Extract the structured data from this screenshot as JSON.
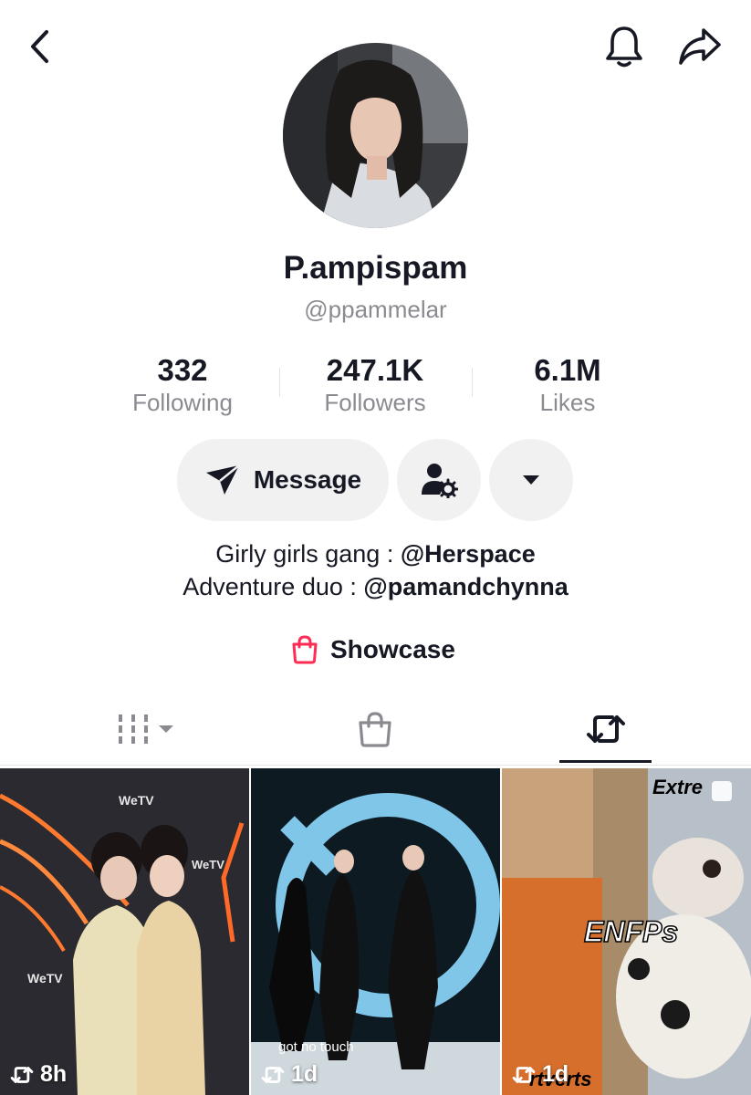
{
  "profile": {
    "display_name": "P.ampispam",
    "username": "@ppammelar"
  },
  "stats": [
    {
      "value": "332",
      "label": "Following"
    },
    {
      "value": "247.1K",
      "label": "Followers"
    },
    {
      "value": "6.1M",
      "label": "Likes"
    }
  ],
  "actions": {
    "message_label": "Message"
  },
  "bio": {
    "line1_text": "Girly girls gang : ",
    "line1_mention": "@Herspace",
    "line2_text": "Adventure duo : ",
    "line2_mention": "@pamandchynna"
  },
  "showcase": {
    "label": "Showcase"
  },
  "tabs": [
    {
      "name": "videos",
      "icon": "grid-icon",
      "active": false
    },
    {
      "name": "shop",
      "icon": "shopping-bag-icon",
      "active": false
    },
    {
      "name": "reposts",
      "icon": "repost-icon",
      "active": true
    }
  ],
  "videos": [
    {
      "time": "8h",
      "overlay_text": "WeTV",
      "icon": "repost-icon"
    },
    {
      "time": "1d",
      "overlay_text": "got no touch",
      "icon": "repost-icon"
    },
    {
      "time": "1d",
      "overlay_text": "ENFPs",
      "top_text": "Extre",
      "bottom_text": "rtverts",
      "icon": "repost-icon"
    }
  ],
  "colors": {
    "primary_text": "#161823",
    "secondary_text": "#8a8b91",
    "button_bg": "#f1f1f2",
    "showcase_accent": "#fe2c55"
  }
}
